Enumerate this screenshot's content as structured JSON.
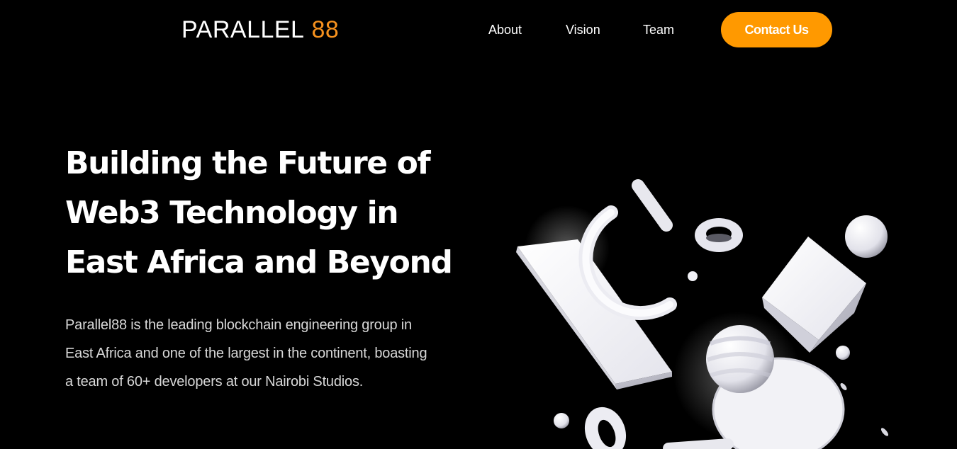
{
  "nav": {
    "logo_text": "PARALLEL",
    "logo_number": "88",
    "links": [
      "About",
      "Vision",
      "Team"
    ],
    "cta_label": "Contact Us"
  },
  "hero": {
    "title_lines": [
      "Building the Future of",
      "Web3 Technology in",
      "East Africa and Beyond"
    ],
    "description_lines": [
      "Parallel88 is the leading blockchain engineering group in",
      "East Africa and one of the largest in the continent, boasting",
      "a team of 60+ developers at our Nairobi Studios."
    ]
  },
  "colors": {
    "background": "#000000",
    "accent": "#ff9900",
    "logo_number": "#f7921e",
    "text": "#ffffff",
    "muted_text": "#d8d8d8"
  }
}
